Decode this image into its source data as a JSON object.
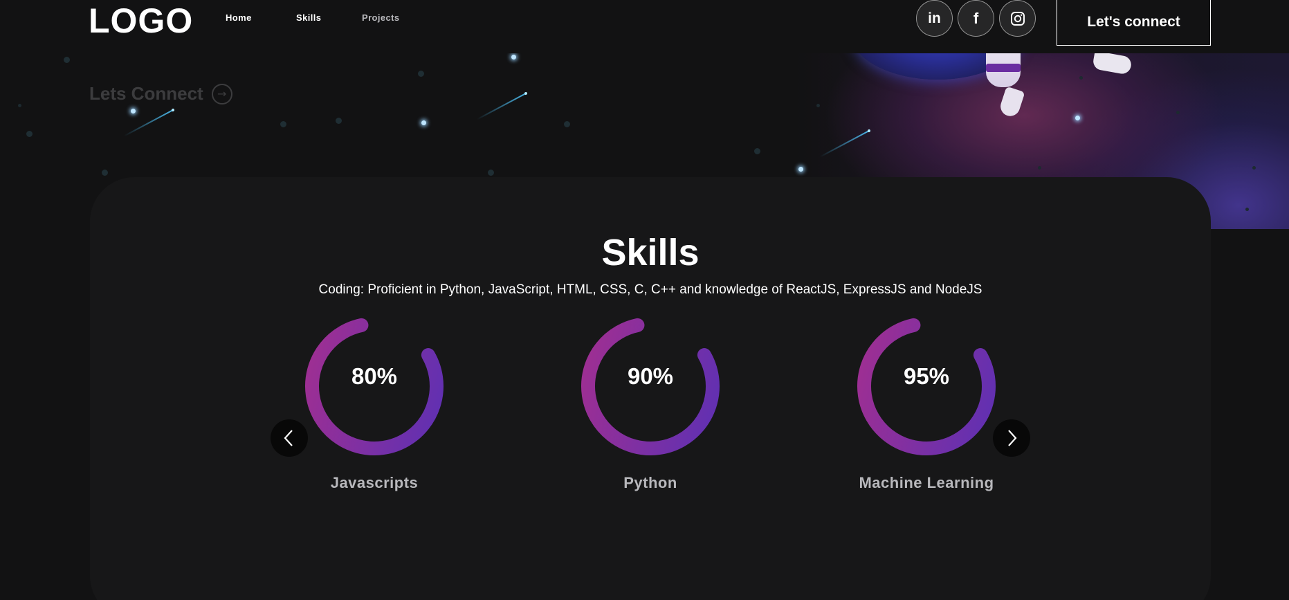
{
  "nav": {
    "logo": "LOGO",
    "links": [
      "Home",
      "Skills",
      "Projects"
    ],
    "socials": [
      {
        "name": "linkedin",
        "glyph": "in"
      },
      {
        "name": "facebook",
        "glyph": "f"
      },
      {
        "name": "instagram",
        "glyph": ""
      }
    ],
    "connect_label": "Let's connect"
  },
  "hero": {
    "cta_label": "Lets Connect",
    "cta_icon": "arrow-right-circle-icon"
  },
  "skills": {
    "title": "Skills",
    "description": "Coding: Proficient in Python, JavaScript, HTML, CSS, C, C++ and knowledge of ReactJS, ExpressJS and NodeJS",
    "items": [
      {
        "percent_label": "80%",
        "label": "Javascripts",
        "ring_fill": 0.8
      },
      {
        "percent_label": "90%",
        "label": "Python",
        "ring_fill": 0.8
      },
      {
        "percent_label": "95%",
        "label": "Machine Learning",
        "ring_fill": 0.8
      }
    ],
    "prev_icon": "chevron-left-icon",
    "next_icon": "chevron-right-icon"
  },
  "colors": {
    "ring_start": "#a52f8f",
    "ring_end": "#5a30b5",
    "background": "#121213",
    "card": "#171718"
  }
}
